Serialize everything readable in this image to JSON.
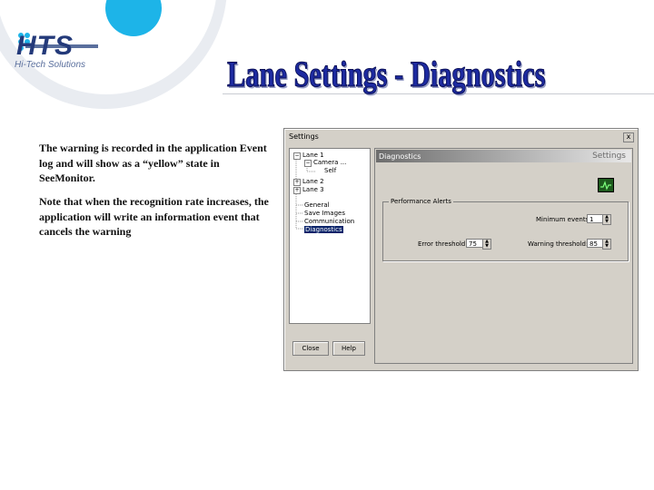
{
  "logo": {
    "brand": "HTS",
    "tagline": "Hi-Tech Solutions"
  },
  "slide": {
    "title": "Lane Settings - Diagnostics",
    "paragraphs": [
      "The warning is recorded in the application Event log and will show as a “yellow” state in SeeMonitor.",
      "Note that when the recognition rate increases, the application will write an information event that cancels the warning"
    ]
  },
  "dialog": {
    "title": "Settings",
    "close_label": "x",
    "tree": {
      "items": [
        {
          "label": "Lane 1",
          "expander": "−"
        },
        {
          "label": "Camera ...",
          "expander": "−"
        },
        {
          "label": "Self",
          "expander": ""
        },
        {
          "label": "Lane 2",
          "expander": "+"
        },
        {
          "label": "Lane 3",
          "expander": "+"
        },
        {
          "label": "General",
          "expander": ""
        },
        {
          "label": "Save Images",
          "expander": ""
        },
        {
          "label": "Communication",
          "expander": ""
        },
        {
          "label": "Diagnostics",
          "expander": ""
        }
      ]
    },
    "buttons": {
      "close": "Close",
      "help": "Help"
    },
    "panel": {
      "title": "Diagnostics",
      "header_right": "Settings",
      "group_label": "Performance Alerts",
      "min_events_label": "Minimum events:",
      "min_events_value": "1",
      "error_threshold_label": "Error threshold:",
      "error_threshold_value": "75",
      "warning_threshold_label": "Warning threshold:",
      "warning_threshold_value": "85"
    }
  },
  "colors": {
    "accent_blue": "#1db4e8",
    "title_blue": "#1d2aa0",
    "selection": "#0a246a"
  }
}
